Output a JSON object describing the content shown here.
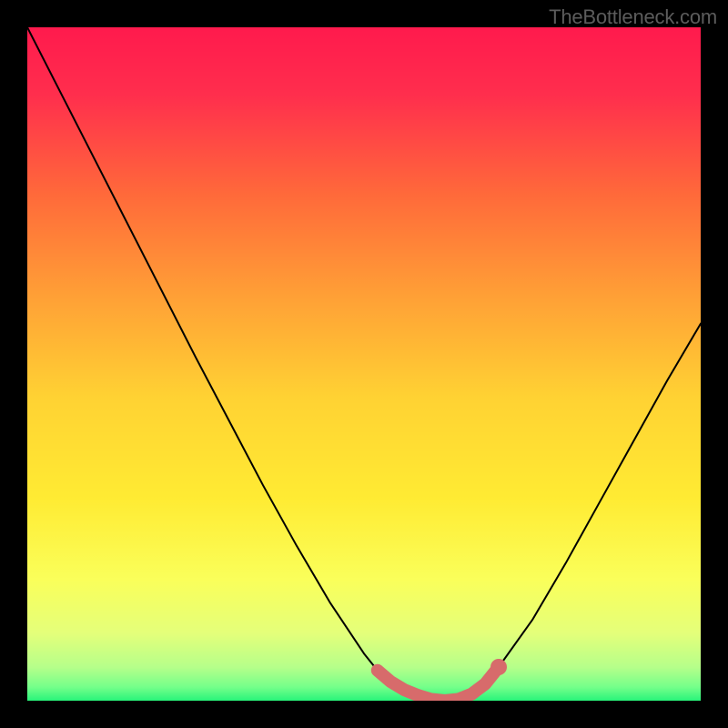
{
  "watermark": "TheBottleneck.com",
  "chart_data": {
    "type": "line",
    "title": "",
    "xlabel": "",
    "ylabel": "",
    "xlim": [
      0,
      100
    ],
    "ylim": [
      0,
      100
    ],
    "x": [
      0,
      5,
      10,
      15,
      20,
      25,
      30,
      35,
      40,
      45,
      50,
      52,
      54,
      56,
      58,
      60,
      62,
      64,
      66,
      68,
      70,
      75,
      80,
      85,
      90,
      95,
      100
    ],
    "values": [
      100,
      90.2,
      80.4,
      70.6,
      60.8,
      51.0,
      41.5,
      32.0,
      23.0,
      14.5,
      7.0,
      4.5,
      2.8,
      1.6,
      0.8,
      0.2,
      0.0,
      0.2,
      1.0,
      2.5,
      5.0,
      12.0,
      20.5,
      29.5,
      38.5,
      47.5,
      56.0
    ],
    "bottom_band_x": [
      52,
      54,
      56,
      58,
      60,
      62,
      64,
      66,
      68,
      70
    ],
    "bottom_band_y": [
      4.5,
      2.8,
      1.6,
      0.8,
      0.2,
      0.0,
      0.2,
      1.0,
      2.5,
      5.0
    ],
    "gradient_stops": [
      {
        "offset": 0.0,
        "color": "#ff1a4d"
      },
      {
        "offset": 0.1,
        "color": "#ff2e4d"
      },
      {
        "offset": 0.25,
        "color": "#ff6a3a"
      },
      {
        "offset": 0.4,
        "color": "#ffa036"
      },
      {
        "offset": 0.55,
        "color": "#ffd233"
      },
      {
        "offset": 0.7,
        "color": "#ffeb33"
      },
      {
        "offset": 0.82,
        "color": "#faff5a"
      },
      {
        "offset": 0.9,
        "color": "#e4ff7a"
      },
      {
        "offset": 0.95,
        "color": "#b6ff8a"
      },
      {
        "offset": 0.98,
        "color": "#74ff8a"
      },
      {
        "offset": 1.0,
        "color": "#28f47a"
      }
    ]
  }
}
